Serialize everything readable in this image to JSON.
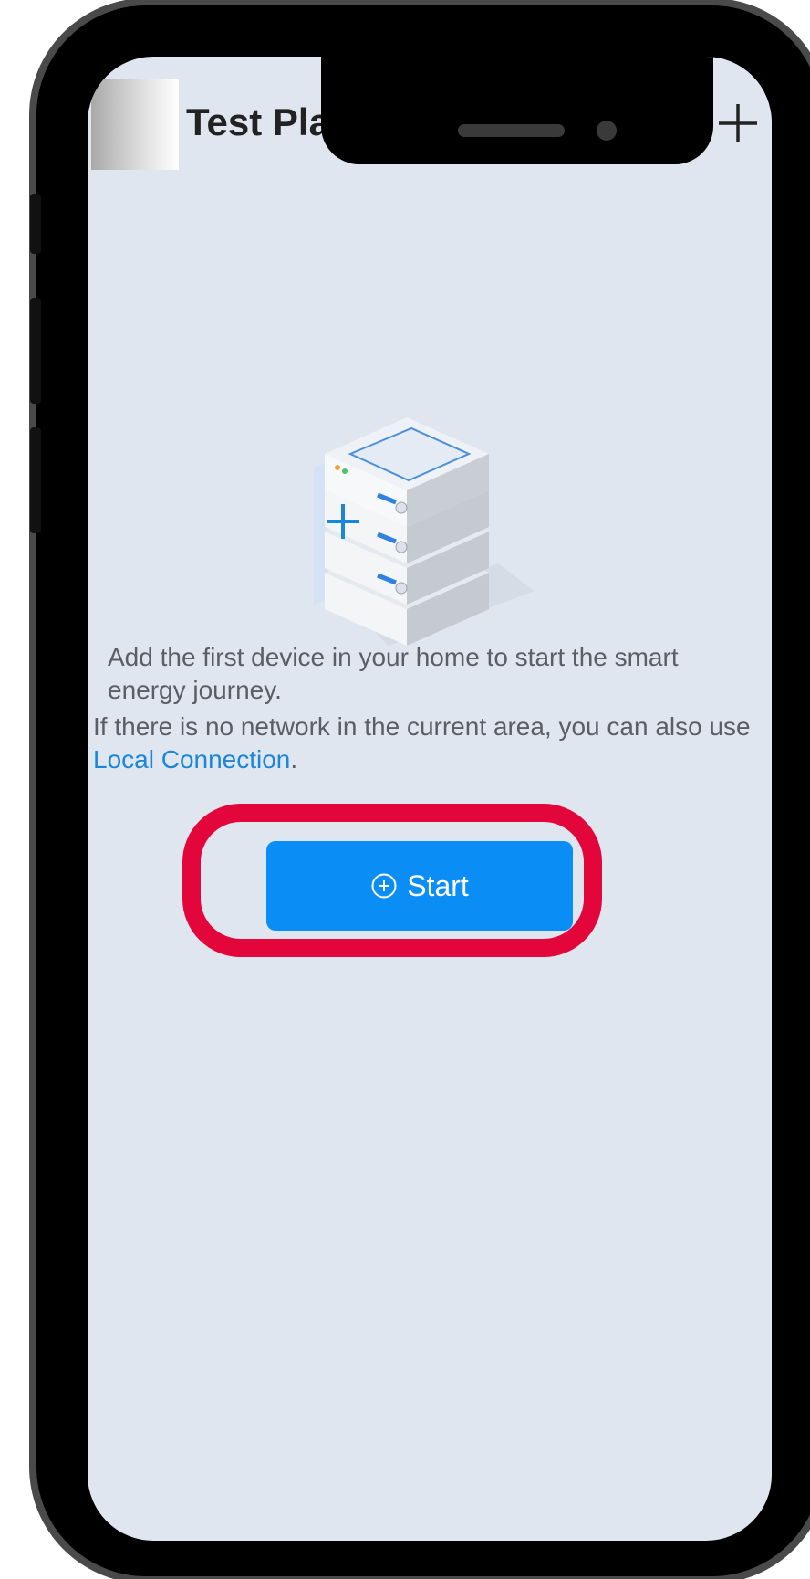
{
  "header": {
    "plant_name": "Test Plant",
    "add_icon": "plus-icon",
    "dropdown_icon": "caret-down-icon"
  },
  "empty_state": {
    "illustration_icon": "device-stack-illustration",
    "description": "Add the first device in your home to start the smart energy journey.",
    "network_prefix": "If there is no network in the current area, you can also use ",
    "local_connection_link": "Local Connection",
    "network_suffix": "."
  },
  "start_button": {
    "label": "Start",
    "icon": "plus-circle-icon"
  },
  "colors": {
    "accent": "#0a8ef5",
    "link": "#1a86d8",
    "highlight": "#e2063a",
    "background": "#e0e6ef"
  }
}
